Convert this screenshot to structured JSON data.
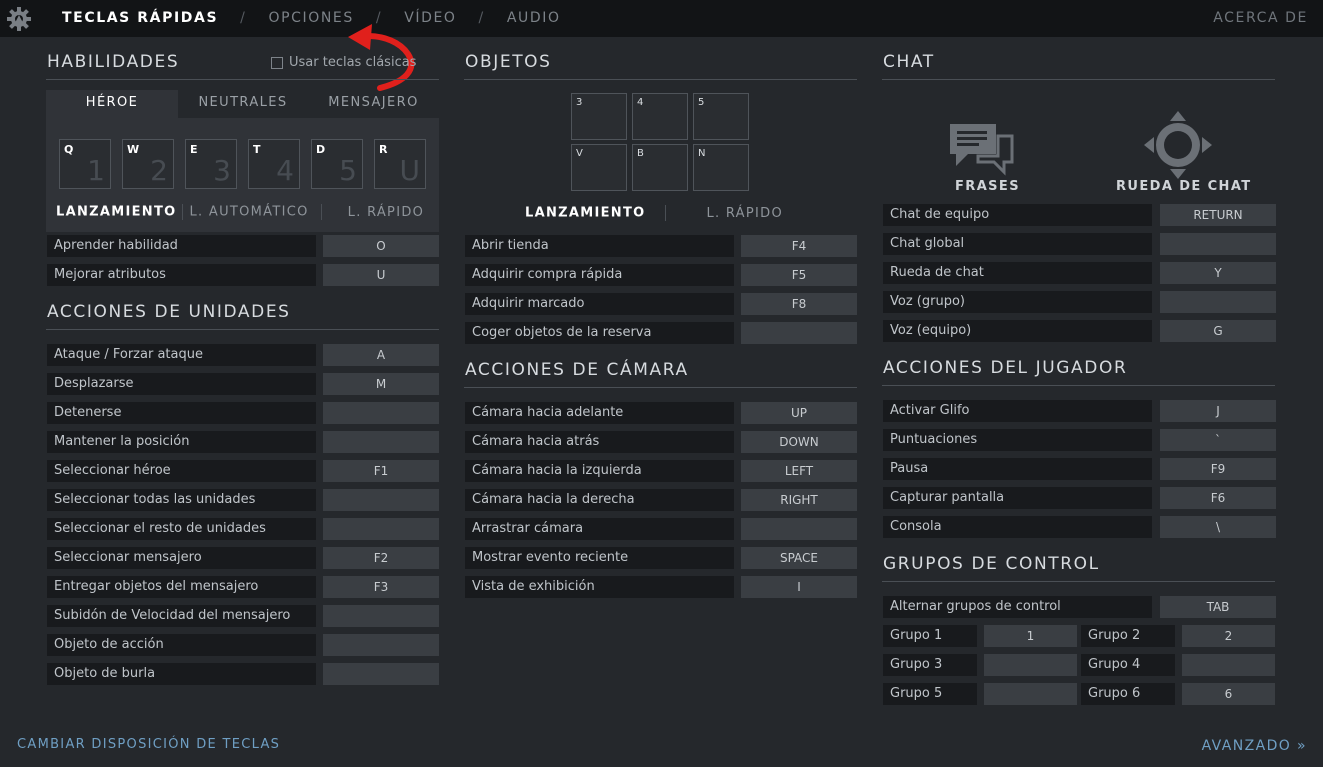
{
  "nav": {
    "tabs": [
      "TECLAS RÁPIDAS",
      "OPCIONES",
      "VÍDEO",
      "AUDIO"
    ],
    "separator": "/",
    "about": "ACERCA DE",
    "settings_icon": "gear-icon"
  },
  "habilidades": {
    "title": "HABILIDADES",
    "checkbox_label": "Usar teclas clásicas",
    "tabs": [
      "HÉROE",
      "NEUTRALES",
      "MENSAJERO"
    ],
    "slots": [
      {
        "key": "Q",
        "num": "1"
      },
      {
        "key": "W",
        "num": "2"
      },
      {
        "key": "E",
        "num": "3"
      },
      {
        "key": "T",
        "num": "4"
      },
      {
        "key": "D",
        "num": "5"
      },
      {
        "key": "R",
        "num": "U"
      }
    ],
    "modes": [
      "LANZAMIENTO",
      "L. AUTOMÁTICO",
      "L. RÁPIDO"
    ],
    "rows": [
      {
        "label": "Aprender habilidad",
        "key": "O"
      },
      {
        "label": "Mejorar atributos",
        "key": "U"
      }
    ]
  },
  "unidades": {
    "title": "ACCIONES DE UNIDADES",
    "rows": [
      {
        "label": "Ataque / Forzar ataque",
        "key": "A"
      },
      {
        "label": "Desplazarse",
        "key": "M"
      },
      {
        "label": "Detenerse",
        "key": ""
      },
      {
        "label": "Mantener la posición",
        "key": ""
      },
      {
        "label": "Seleccionar héroe",
        "key": "F1"
      },
      {
        "label": "Seleccionar todas las unidades",
        "key": ""
      },
      {
        "label": "Seleccionar el resto de unidades",
        "key": ""
      },
      {
        "label": "Seleccionar mensajero",
        "key": "F2"
      },
      {
        "label": "Entregar objetos del mensajero",
        "key": "F3"
      },
      {
        "label": "Subidón de Velocidad del mensajero",
        "key": ""
      },
      {
        "label": "Objeto de acción",
        "key": ""
      },
      {
        "label": "Objeto de burla",
        "key": ""
      }
    ]
  },
  "objetos": {
    "title": "OBJETOS",
    "slots": [
      "3",
      "4",
      "5",
      "V",
      "B",
      "N"
    ],
    "modes": [
      "LANZAMIENTO",
      "L. RÁPIDO"
    ],
    "rows": [
      {
        "label": "Abrir tienda",
        "key": "F4"
      },
      {
        "label": "Adquirir compra rápida",
        "key": "F5"
      },
      {
        "label": "Adquirir marcado",
        "key": "F8"
      },
      {
        "label": "Coger objetos de la reserva",
        "key": ""
      }
    ]
  },
  "camara": {
    "title": "ACCIONES DE CÁMARA",
    "rows": [
      {
        "label": "Cámara hacia adelante",
        "key": "UP"
      },
      {
        "label": "Cámara hacia atrás",
        "key": "DOWN"
      },
      {
        "label": "Cámara hacia la izquierda",
        "key": "LEFT"
      },
      {
        "label": "Cámara hacia la derecha",
        "key": "RIGHT"
      },
      {
        "label": "Arrastrar cámara",
        "key": ""
      },
      {
        "label": "Mostrar evento reciente",
        "key": "SPACE"
      },
      {
        "label": "Vista de exhibición",
        "key": "I"
      }
    ]
  },
  "chat": {
    "title": "CHAT",
    "icons": [
      {
        "label": "FRASES",
        "icon": "chat-bubbles-icon"
      },
      {
        "label": "RUEDA DE CHAT",
        "icon": "chat-wheel-icon"
      }
    ],
    "rows": [
      {
        "label": "Chat de equipo",
        "key": "RETURN"
      },
      {
        "label": "Chat global",
        "key": ""
      },
      {
        "label": "Rueda de chat",
        "key": "Y"
      },
      {
        "label": "Voz (grupo)",
        "key": ""
      },
      {
        "label": "Voz (equipo)",
        "key": "G"
      }
    ]
  },
  "jugador": {
    "title": "ACCIONES DEL JUGADOR",
    "rows": [
      {
        "label": "Activar Glifo",
        "key": "J"
      },
      {
        "label": "Puntuaciones",
        "key": "`"
      },
      {
        "label": "Pausa",
        "key": "F9"
      },
      {
        "label": "Capturar pantalla",
        "key": "F6"
      },
      {
        "label": "Consola",
        "key": "\\"
      }
    ]
  },
  "grupos": {
    "title": "GRUPOS DE CONTROL",
    "toggle": {
      "label": "Alternar grupos de control",
      "key": "TAB"
    },
    "groups": [
      {
        "label": "Grupo 1",
        "key": "1"
      },
      {
        "label": "Grupo 2",
        "key": "2"
      },
      {
        "label": "Grupo 3",
        "key": ""
      },
      {
        "label": "Grupo 4",
        "key": ""
      },
      {
        "label": "Grupo 5",
        "key": ""
      },
      {
        "label": "Grupo 6",
        "key": "6"
      }
    ]
  },
  "footer": {
    "left": "CAMBIAR DISPOSICIÓN DE TECLAS",
    "right": "AVANZADO »"
  }
}
